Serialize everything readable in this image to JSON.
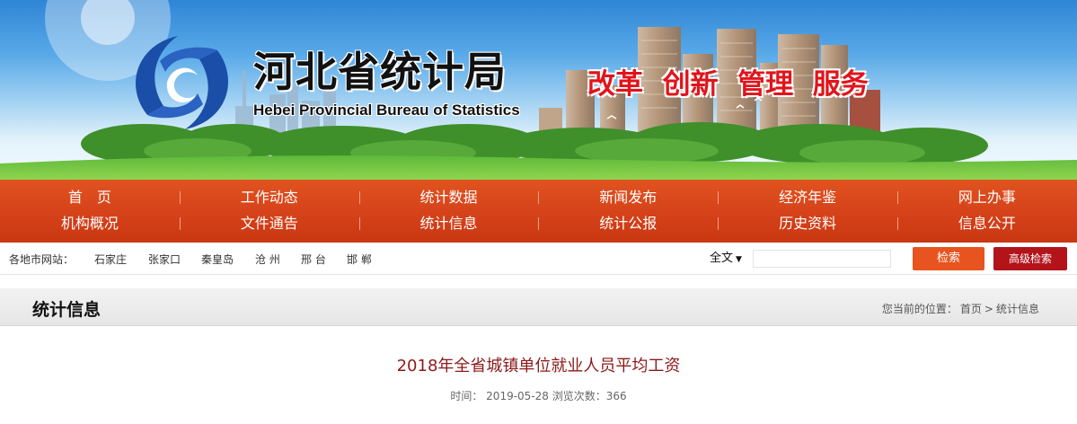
{
  "banner": {
    "title": "河北省统计局",
    "subtitle": "Hebei Provincial Bureau of Statistics",
    "slogan": "改革  创新  管理  服务"
  },
  "nav": {
    "row1": [
      "首　页",
      "工作动态",
      "统计数据",
      "新闻发布",
      "经济年鉴",
      "网上办事"
    ],
    "row2": [
      "机构概况",
      "文件通告",
      "统计信息",
      "统计公报",
      "历史资料",
      "信息公开"
    ]
  },
  "citybar": {
    "label": "各地市网站：",
    "cities": [
      "石家庄",
      "张家口",
      "秦皇岛",
      "沧 州",
      "邢 台",
      "邯 郸"
    ],
    "search_scope": "全文",
    "search_value": "",
    "search_button": "检索",
    "advanced_button": "高级检索"
  },
  "section": {
    "title": "统计信息",
    "breadcrumb_prefix": "您当前的位置：",
    "breadcrumb_home": "首页",
    "breadcrumb_sep": ">",
    "breadcrumb_current": "统计信息"
  },
  "article": {
    "title": "2018年全省城镇单位就业人员平均工资",
    "meta": "时间： 2019-05-28 浏览次数：366"
  },
  "colors": {
    "nav_orange": "#d6431a",
    "search_button": "#e7541f",
    "advanced_button": "#b2141a",
    "slogan_red": "#e1141b",
    "article_title": "#8b1a1a"
  },
  "icons": {
    "logo": "hebei-statistics-swirl-logo",
    "dropdown": "caret-down-icon"
  }
}
